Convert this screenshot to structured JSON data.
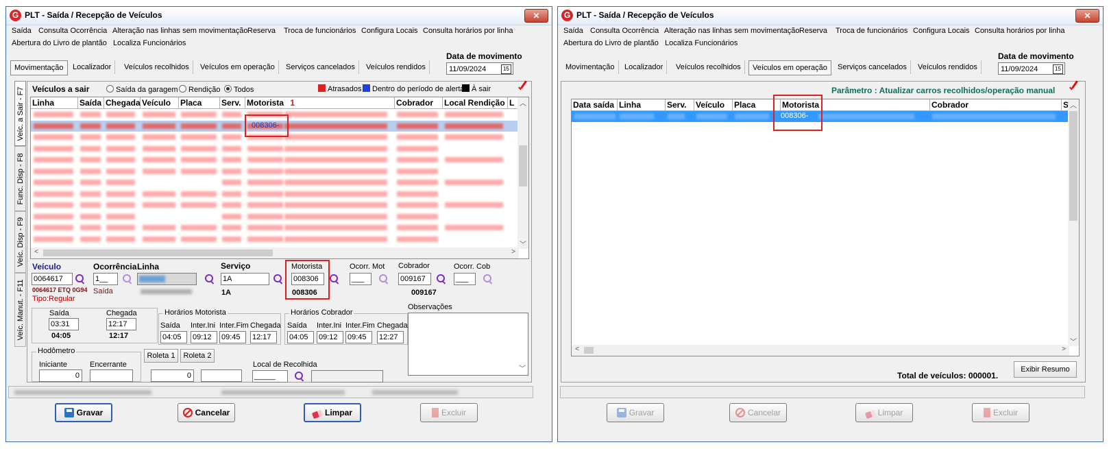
{
  "left_window": {
    "title": "PLT - Saída / Recepção de Veículos",
    "close_label": "✕",
    "menu": [
      "Saída",
      "Consulta Ocorrência",
      "Alteração nas linhas sem movimentação",
      "Reserva",
      "Troca de funcionários",
      "Configura Locais",
      "Consulta horários por linha",
      "Abertura do Livro de plantão",
      "Localiza Funcionários"
    ],
    "tabs": [
      "Movimentação",
      "Localizador",
      "Veículos recolhidos",
      "Veículos em operação",
      "Serviços cancelados",
      "Veículos rendidos"
    ],
    "active_tab": "Movimentação",
    "date_label": "Data de movimento",
    "date_value": "11/09/2024",
    "side_tabs": [
      "Veíc. a Sair - F7",
      "Func. Disp - F8",
      "Veíc. Disp - F9",
      "Veíc. Manut. - F11"
    ],
    "filter": {
      "title": "Veículos a sair",
      "options": [
        "Saída da garagem",
        "Rendição",
        "Todos"
      ],
      "selected": "Todos"
    },
    "legend": [
      {
        "label": "Atrasados",
        "color": "#e02020"
      },
      {
        "label": "Dentro do período de alerta",
        "color": "#1f3fe0"
      },
      {
        "label": "À sair",
        "color": "#000000"
      }
    ],
    "grid_headers": [
      "Linha",
      "Saída",
      "Chegada",
      "Veículo",
      "Placa",
      "Serv.",
      "Motorista",
      "1",
      "Cobrador",
      "Local Rendição",
      "L"
    ],
    "grid_highlight_motorista": "008306-",
    "vehicle": {
      "veiculo_label": "Veículo",
      "veiculo_value": "0064617",
      "veiculo_desc": "0064617 ETQ 0G94",
      "tipo": "Tipo:Regular",
      "ocorrencia_label": "Ocorrência",
      "ocorrencia_value": "1__",
      "ocorrencia_desc": "Saída",
      "linha_label": "Linha",
      "servico_label": "Serviço",
      "servico_value": "1A",
      "servico_desc": "1A",
      "motorista_label": "Motorista",
      "motorista_value": "008306",
      "motorista_desc": "008306",
      "ocorr_mot_label": "Ocorr. Mot",
      "ocorr_mot_value": "___",
      "cobrador_label": "Cobrador",
      "cobrador_value": "009167",
      "cobrador_desc": "009167",
      "ocorr_cob_label": "Ocorr. Cob",
      "ocorr_cob_value": "___"
    },
    "times": {
      "saida_label": "Saída",
      "saida_value": "03:31",
      "saida_bold": "04:05",
      "chegada_label": "Chegada",
      "chegada_value": "12:17",
      "chegada_bold": "12:17"
    },
    "horarios_motorista": {
      "title": "Horários Motorista",
      "headers": [
        "Saída",
        "Inter.Ini",
        "Inter.Fim",
        "Chegada"
      ],
      "values": [
        "04:05",
        "09:12",
        "09:45",
        "12:17"
      ]
    },
    "horarios_cobrador": {
      "title": "Horários Cobrador",
      "headers": [
        "Saída",
        "Inter.Ini",
        "Inter.Fim",
        "Chegada"
      ],
      "values": [
        "04:05",
        "09:12",
        "09:45",
        "12:27"
      ]
    },
    "observacoes_label": "Observações",
    "hodometro": {
      "title": "Hodômetro",
      "iniciante_label": "Iniciante",
      "iniciante_value": "0",
      "encerrante_label": "Encerrante",
      "encerrante_value": ""
    },
    "roleta1": "Roleta 1",
    "roleta2": "Roleta 2",
    "roleta_value": "0",
    "local_recolhida_label": "Local de Recolhida",
    "local_recolhida_value": "_____",
    "buttons": [
      "Gravar",
      "Cancelar",
      "Limpar",
      "Excluir"
    ]
  },
  "right_window": {
    "title": "PLT - Saída / Recepção de Veículos",
    "close_label": "✕",
    "menu": [
      "Saída",
      "Consulta Ocorrência",
      "Alteração nas linhas sem movimentação",
      "Reserva",
      "Troca de funcionários",
      "Configura Locais",
      "Consulta horários por linha",
      "Abertura do Livro de plantão",
      "Localiza Funcionários"
    ],
    "tabs": [
      "Movimentação",
      "Localizador",
      "Veículos recolhidos",
      "Veículos em operação",
      "Serviços cancelados",
      "Veículos rendidos"
    ],
    "active_tab": "Veículos em operação",
    "date_label": "Data de movimento",
    "date_value": "11/09/2024",
    "parametro": "Parâmetro : Atualizar carros recolhidos/operação manual",
    "grid_headers": [
      "Data saída",
      "Linha",
      "Serv.",
      "Veículo",
      "Placa",
      "Motorista",
      "Cobrador",
      "S"
    ],
    "grid_highlight_motorista": "008306-",
    "total_label": "Total de veículos:",
    "total_value": "000001.",
    "exibir_resumo": "Exibir Resumo",
    "buttons": [
      "Gravar",
      "Cancelar",
      "Limpar",
      "Excluir"
    ]
  }
}
